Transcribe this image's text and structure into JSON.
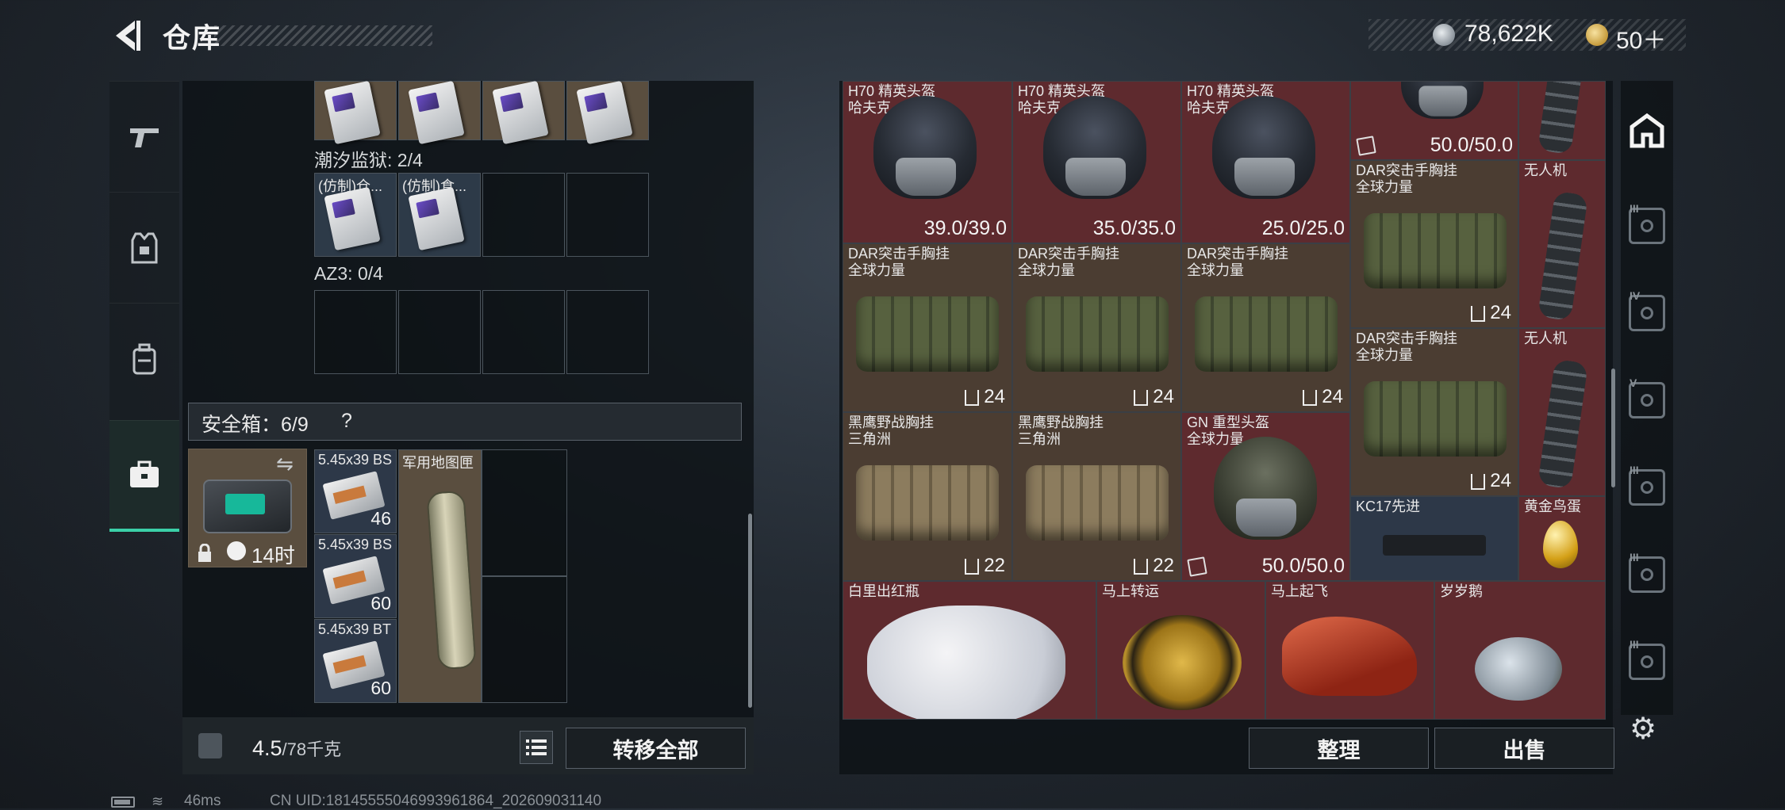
{
  "header": {
    "title": "仓库",
    "currency_silver": "78,622K",
    "currency_gold": "50＋",
    "icons": [
      "back-arrow-icon",
      "silver-coin-icon",
      "gold-coin-icon"
    ]
  },
  "left_nav": [
    "gun-icon",
    "armor-vest-icon",
    "backpack-icon",
    "safebox-icon"
  ],
  "left_panel": {
    "top_row_cards": 4,
    "section1": {
      "label": "潮汐监狱: 2/4",
      "items": [
        "(仿制)仓...",
        "(仿制)食..."
      ]
    },
    "section2": {
      "label": "AZ3: 0/4"
    },
    "safebox": {
      "label": "安全箱：6/9",
      "help": "?",
      "timer": "14时",
      "ammo": [
        {
          "name": "5.45x39 BS",
          "count": "46"
        },
        {
          "name": "5.45x39 BS",
          "count": "60"
        },
        {
          "name": "5.45x39 BT",
          "count": "60"
        }
      ],
      "map_case": "军用地图匣"
    },
    "weight_value": "4.5",
    "weight_unit": "/78千克",
    "transfer_all": "转移全部"
  },
  "right_panel": {
    "helmets": [
      {
        "name": "H70 精英头盔",
        "sub": "哈夫克",
        "durability": "39.0/39.0"
      },
      {
        "name": "H70 精英头盔",
        "sub": "哈夫克",
        "durability": "35.0/35.0"
      },
      {
        "name": "H70 精英头盔",
        "sub": "哈夫克",
        "durability": "25.0/25.0"
      }
    ],
    "top_right_helmet_durability": "50.0/50.0",
    "dar_vests": [
      {
        "name": "DAR突击手胸挂",
        "sub": "全球力量",
        "qty": "24"
      },
      {
        "name": "DAR突击手胸挂",
        "sub": "全球力量",
        "qty": "24"
      },
      {
        "name": "DAR突击手胸挂",
        "sub": "全球力量",
        "qty": "24"
      },
      {
        "name": "DAR突击手胸挂",
        "sub": "全球力量",
        "qty": "24"
      },
      {
        "name": "DAR突击手胸挂",
        "sub": "全球力量",
        "qty": "24"
      }
    ],
    "drones": [
      {
        "name": "无人机",
        "qty": ""
      },
      {
        "name": "无人机",
        "qty": ""
      }
    ],
    "blackhawk": [
      {
        "name": "黑鹰野战胸挂",
        "sub": "三角洲",
        "qty": "22"
      },
      {
        "name": "黑鹰野战胸挂",
        "sub": "三角洲",
        "qty": "22"
      }
    ],
    "gn_helmet": {
      "name": "GN 重型头盔",
      "sub": "全球力量",
      "durability": "50.0/50.0"
    },
    "kc17": {
      "name": "KC17先进"
    },
    "golden_egg": {
      "name": "黄金鸟蛋"
    },
    "collectibles": [
      "白里出红瓶",
      "马上转运",
      "马上起飞",
      "岁岁鹅"
    ],
    "sort_btn": "整理",
    "sell_btn": "出售"
  },
  "right_nav": [
    "home-icon",
    "III",
    "IV",
    "V",
    "III",
    "III",
    "III"
  ],
  "status": {
    "ping": "46ms",
    "uid": "CN UID:1814555504699396186​4_202609031140"
  }
}
